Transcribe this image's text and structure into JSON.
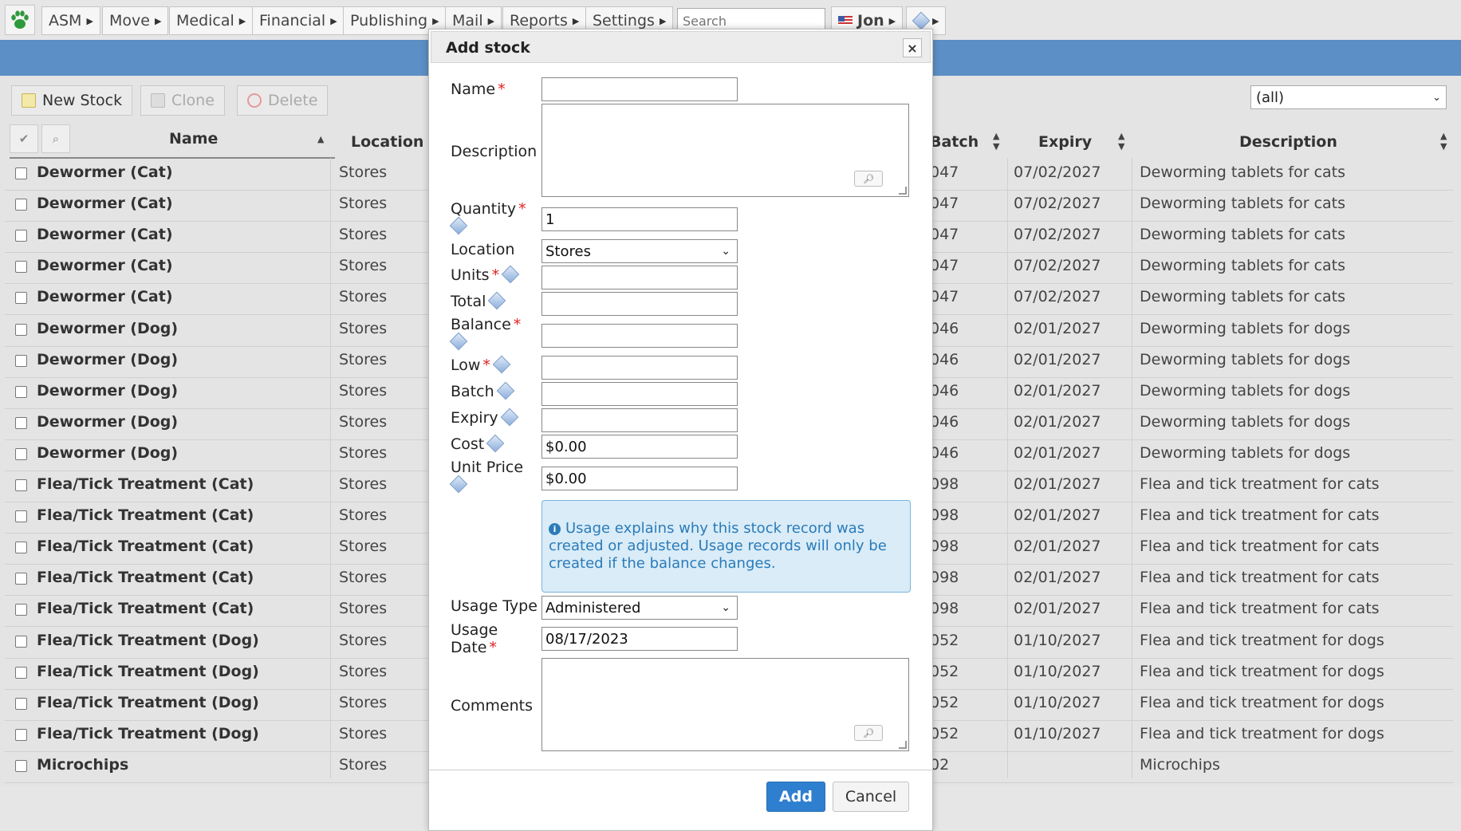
{
  "nav": {
    "items": [
      {
        "label": "ASM"
      },
      {
        "label": "Move"
      },
      {
        "label": "Medical"
      },
      {
        "label": "Financial"
      },
      {
        "label": "Publishing"
      },
      {
        "label": "Mail"
      },
      {
        "label": "Reports"
      },
      {
        "label": "Settings"
      }
    ],
    "search_placeholder": "Search",
    "user": "Jon"
  },
  "toolbar": {
    "new_stock": "New Stock",
    "clone": "Clone",
    "delete": "Delete",
    "filter_value": "(all)"
  },
  "grid": {
    "columns": {
      "name": "Name",
      "location": "Location",
      "batch": "Batch",
      "expiry": "Expiry",
      "description": "Description"
    },
    "rows": [
      {
        "name": "Dewormer (Cat)",
        "location": "Stores",
        "batch": "047",
        "expiry": "07/02/2027",
        "description": "Deworming tablets for cats"
      },
      {
        "name": "Dewormer (Cat)",
        "location": "Stores",
        "batch": "047",
        "expiry": "07/02/2027",
        "description": "Deworming tablets for cats"
      },
      {
        "name": "Dewormer (Cat)",
        "location": "Stores",
        "batch": "047",
        "expiry": "07/02/2027",
        "description": "Deworming tablets for cats"
      },
      {
        "name": "Dewormer (Cat)",
        "location": "Stores",
        "batch": "047",
        "expiry": "07/02/2027",
        "description": "Deworming tablets for cats"
      },
      {
        "name": "Dewormer (Cat)",
        "location": "Stores",
        "batch": "047",
        "expiry": "07/02/2027",
        "description": "Deworming tablets for cats"
      },
      {
        "name": "Dewormer (Dog)",
        "location": "Stores",
        "batch": "046",
        "expiry": "02/01/2027",
        "description": "Deworming tablets for dogs"
      },
      {
        "name": "Dewormer (Dog)",
        "location": "Stores",
        "batch": "046",
        "expiry": "02/01/2027",
        "description": "Deworming tablets for dogs"
      },
      {
        "name": "Dewormer (Dog)",
        "location": "Stores",
        "batch": "046",
        "expiry": "02/01/2027",
        "description": "Deworming tablets for dogs"
      },
      {
        "name": "Dewormer (Dog)",
        "location": "Stores",
        "batch": "046",
        "expiry": "02/01/2027",
        "description": "Deworming tablets for dogs"
      },
      {
        "name": "Dewormer (Dog)",
        "location": "Stores",
        "batch": "046",
        "expiry": "02/01/2027",
        "description": "Deworming tablets for dogs"
      },
      {
        "name": "Flea/Tick Treatment (Cat)",
        "location": "Stores",
        "batch": "098",
        "expiry": "02/01/2027",
        "description": "Flea and tick treatment for cats"
      },
      {
        "name": "Flea/Tick Treatment (Cat)",
        "location": "Stores",
        "batch": "098",
        "expiry": "02/01/2027",
        "description": "Flea and tick treatment for cats"
      },
      {
        "name": "Flea/Tick Treatment (Cat)",
        "location": "Stores",
        "batch": "098",
        "expiry": "02/01/2027",
        "description": "Flea and tick treatment for cats"
      },
      {
        "name": "Flea/Tick Treatment (Cat)",
        "location": "Stores",
        "batch": "098",
        "expiry": "02/01/2027",
        "description": "Flea and tick treatment for cats"
      },
      {
        "name": "Flea/Tick Treatment (Cat)",
        "location": "Stores",
        "batch": "098",
        "expiry": "02/01/2027",
        "description": "Flea and tick treatment for cats"
      },
      {
        "name": "Flea/Tick Treatment (Dog)",
        "location": "Stores",
        "batch": "052",
        "expiry": "01/10/2027",
        "description": "Flea and tick treatment for dogs"
      },
      {
        "name": "Flea/Tick Treatment (Dog)",
        "location": "Stores",
        "batch": "052",
        "expiry": "01/10/2027",
        "description": "Flea and tick treatment for dogs"
      },
      {
        "name": "Flea/Tick Treatment (Dog)",
        "location": "Stores",
        "batch": "052",
        "expiry": "01/10/2027",
        "description": "Flea and tick treatment for dogs"
      },
      {
        "name": "Flea/Tick Treatment (Dog)",
        "location": "Stores",
        "batch": "052",
        "expiry": "01/10/2027",
        "description": "Flea and tick treatment for dogs"
      },
      {
        "name": "Microchips",
        "location": "Stores",
        "batch": "02",
        "expiry": "",
        "description": "Microchips"
      }
    ]
  },
  "dialog": {
    "title": "Add stock",
    "close_glyph": "×",
    "required_mark": "*",
    "labels": {
      "name": "Name",
      "description": "Description",
      "quantity": "Quantity",
      "location": "Location",
      "units": "Units",
      "total": "Total",
      "balance": "Balance",
      "low": "Low",
      "batch": "Batch",
      "expiry": "Expiry",
      "cost": "Cost",
      "unit_price_1": "Unit Price",
      "usage_type": "Usage Type",
      "usage_date_1": "Usage",
      "usage_date_2": "Date",
      "comments": "Comments"
    },
    "values": {
      "name": "",
      "quantity": "1",
      "location": "Stores",
      "units": "",
      "total": "",
      "balance": "",
      "low": "",
      "batch": "",
      "expiry": "",
      "cost": "$0.00",
      "unit_price": "$0.00",
      "usage_type": "Administered",
      "usage_date": "08/17/2023"
    },
    "info_text": "Usage explains why this stock record was created or adjusted. Usage records will only be created if the balance changes.",
    "add_button": "Add",
    "cancel_button": "Cancel"
  },
  "colors": {
    "header_blue": "#5b8fc5",
    "primary_button": "#2f7fd0",
    "info_bg": "#d9ecf7",
    "info_text": "#2b7bb9",
    "required": "#e02020"
  }
}
